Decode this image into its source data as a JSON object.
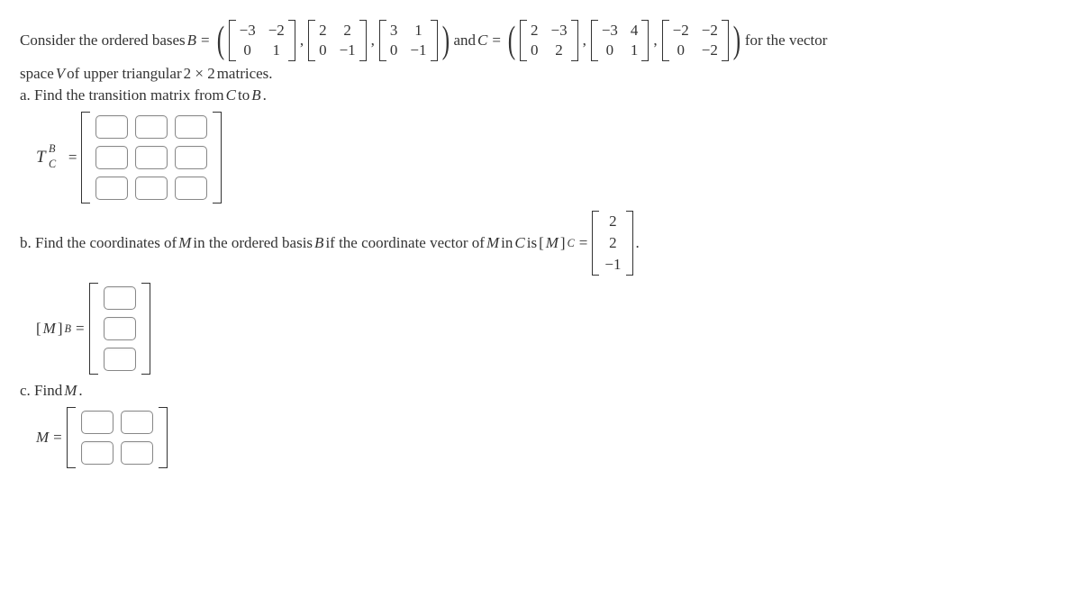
{
  "text": {
    "intro1": "Consider the ordered bases ",
    "and": " and ",
    "intro2": " for the vector",
    "intro3": "space ",
    "intro4": " of upper triangular ",
    "intro5": " matrices.",
    "partA": "a. Find the transition matrix from ",
    "to": " to ",
    "partB1": "b. Find the coordinates of ",
    "partB2": " in the ordered basis ",
    "partB3": " if the coordinate vector of ",
    "partB4": " in ",
    "is": " is ",
    "partC": "c. Find ",
    "period": "."
  },
  "sym": {
    "B": "B",
    "C": "C",
    "V": "V",
    "M": "M",
    "T": "T",
    "eq": "=",
    "lp": "(",
    "rp": ")",
    "comma": ",",
    "two_by_two": "2 × 2"
  },
  "Bmats": [
    [
      [
        "−3",
        "−2"
      ],
      [
        "0",
        "1"
      ]
    ],
    [
      [
        "2",
        "2"
      ],
      [
        "0",
        "−1"
      ]
    ],
    [
      [
        "3",
        "1"
      ],
      [
        "0",
        "−1"
      ]
    ]
  ],
  "Cmats": [
    [
      [
        "2",
        "−3"
      ],
      [
        "0",
        "2"
      ]
    ],
    [
      [
        "−3",
        "4"
      ],
      [
        "0",
        "1"
      ]
    ],
    [
      [
        "−2",
        "−2"
      ],
      [
        "0",
        "−2"
      ]
    ]
  ],
  "Mc": [
    "2",
    "2",
    "−1"
  ]
}
